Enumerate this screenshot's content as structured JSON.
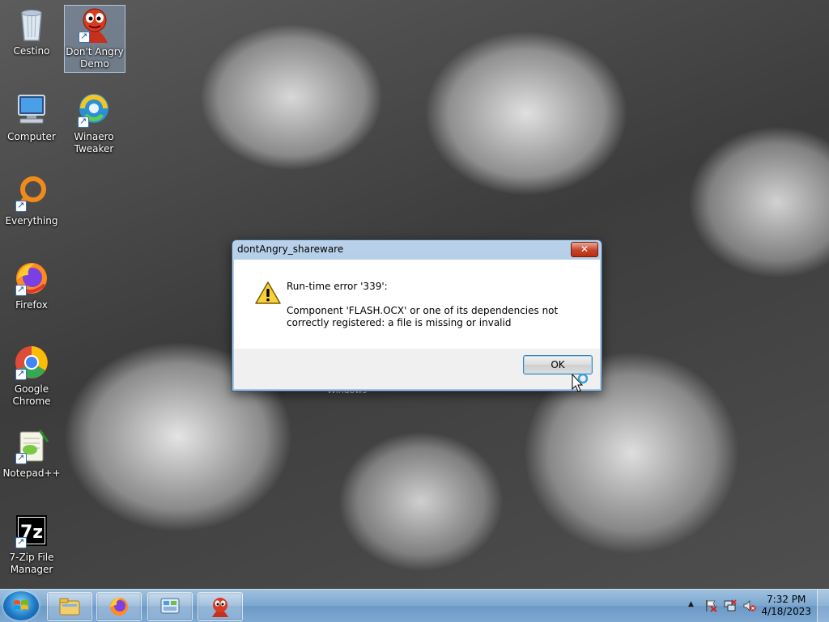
{
  "desktop": {
    "icons": [
      {
        "label": "Cestino"
      },
      {
        "label": "Don't Angry Demo"
      },
      {
        "label": "Computer"
      },
      {
        "label": "Winaero Tweaker"
      },
      {
        "label": "Everything"
      },
      {
        "label": "Firefox"
      },
      {
        "label": "Google Chrome"
      },
      {
        "label": "Notepad++"
      },
      {
        "label": "7-Zip File Manager"
      }
    ],
    "wallpaper_text": "Windows"
  },
  "dialog": {
    "title": "dontAngry_shareware",
    "close_label": "✕",
    "error_title": "Run-time error '339':",
    "error_message": "Component 'FLASH.OCX' or one of its dependencies not correctly registered: a file is missing or invalid",
    "ok_label": "OK"
  },
  "taskbar": {
    "clock_time": "7:32 PM",
    "clock_date": "4/18/2023",
    "tray_arrow": "▲"
  },
  "colors": {
    "taskbar": "#7ba6cf",
    "dialog_frame": "#b9d1ea",
    "close_red": "#c7432a"
  }
}
